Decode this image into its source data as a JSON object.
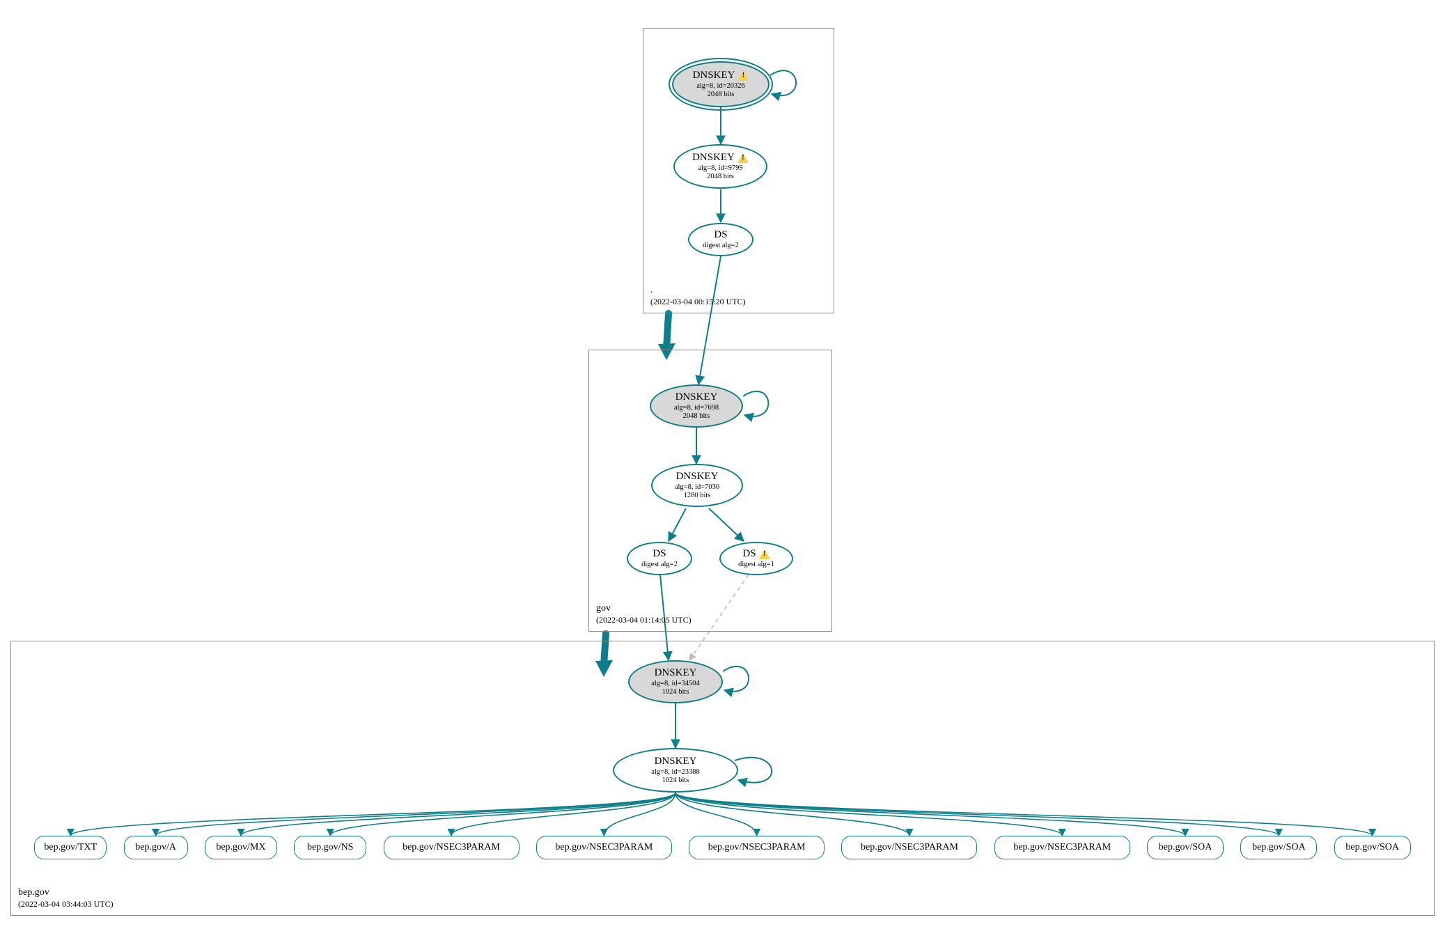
{
  "colors": {
    "edge": "#0d7e8a",
    "zoneBorder": "#888888",
    "grey": "#d8d8d8"
  },
  "zones": {
    "root": {
      "name": ".",
      "timestamp": "(2022-03-04 00:15:20 UTC)"
    },
    "gov": {
      "name": "gov",
      "timestamp": "(2022-03-04 01:14:05 UTC)"
    },
    "bepgov": {
      "name": "bep.gov",
      "timestamp": "(2022-03-04 03:44:03 UTC)"
    }
  },
  "nodes": {
    "root_ksk": {
      "title": "DNSKEY",
      "line1": "alg=8, id=20326",
      "line2": "2048 bits",
      "warning": true
    },
    "root_zsk": {
      "title": "DNSKEY",
      "line1": "alg=8, id=9799",
      "line2": "2048 bits",
      "warning": true
    },
    "root_ds": {
      "title": "DS",
      "line1": "digest alg=2"
    },
    "gov_ksk": {
      "title": "DNSKEY",
      "line1": "alg=8, id=7698",
      "line2": "2048 bits"
    },
    "gov_zsk": {
      "title": "DNSKEY",
      "line1": "alg=8, id=7030",
      "line2": "1280 bits"
    },
    "gov_ds1": {
      "title": "DS",
      "line1": "digest alg=2"
    },
    "gov_ds2": {
      "title": "DS",
      "line1": "digest alg=1",
      "warning": true
    },
    "bep_ksk": {
      "title": "DNSKEY",
      "line1": "alg=8, id=34504",
      "line2": "1024 bits"
    },
    "bep_zsk": {
      "title": "DNSKEY",
      "line1": "alg=8, id=23388",
      "line2": "1024 bits"
    }
  },
  "leaves": [
    "bep.gov/TXT",
    "bep.gov/A",
    "bep.gov/MX",
    "bep.gov/NS",
    "bep.gov/NSEC3PARAM",
    "bep.gov/NSEC3PARAM",
    "bep.gov/NSEC3PARAM",
    "bep.gov/NSEC3PARAM",
    "bep.gov/NSEC3PARAM",
    "bep.gov/SOA",
    "bep.gov/SOA",
    "bep.gov/SOA"
  ]
}
